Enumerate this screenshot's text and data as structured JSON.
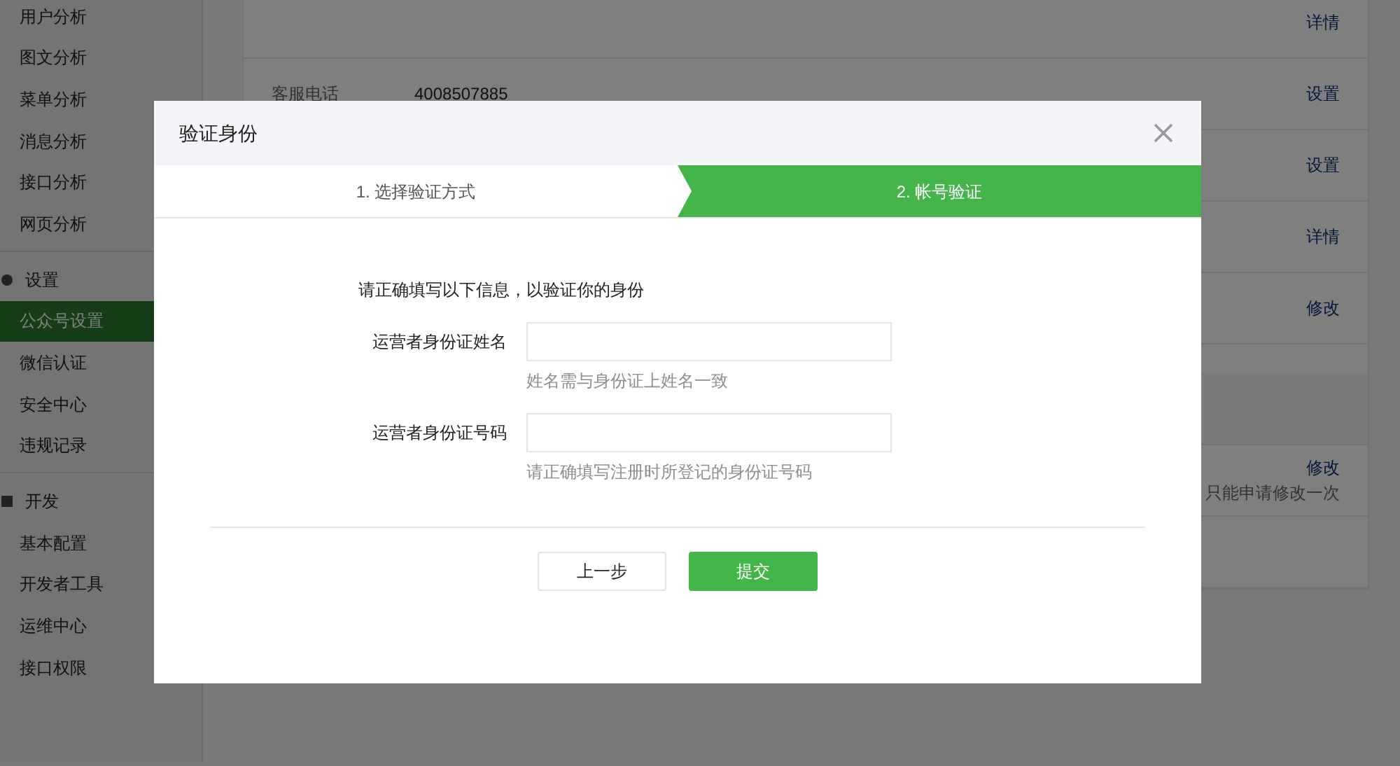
{
  "sidebar": {
    "groups": [
      {
        "items": [
          {
            "label": "用户分析",
            "selected": false
          },
          {
            "label": "图文分析",
            "selected": false
          },
          {
            "label": "菜单分析",
            "selected": false
          },
          {
            "label": "消息分析",
            "selected": false
          },
          {
            "label": "接口分析",
            "selected": false
          },
          {
            "label": "网页分析",
            "selected": false
          }
        ]
      },
      {
        "title": "设置",
        "items": [
          {
            "label": "公众号设置",
            "selected": true
          },
          {
            "label": "微信认证",
            "selected": false
          },
          {
            "label": "安全中心",
            "selected": false
          },
          {
            "label": "违规记录",
            "selected": false
          }
        ]
      },
      {
        "title": "开发",
        "items": [
          {
            "label": "基本配置",
            "selected": false
          },
          {
            "label": "开发者工具",
            "selected": false
          },
          {
            "label": "运维中心",
            "selected": false
          },
          {
            "label": "接口权限",
            "selected": false
          }
        ]
      }
    ]
  },
  "settings_rows": [
    {
      "kind": "row",
      "action": "详情"
    },
    {
      "kind": "row",
      "label": "客服电话",
      "value": "4008507885",
      "action": "设置"
    },
    {
      "kind": "row",
      "action": "设置"
    },
    {
      "kind": "row",
      "action": "详情"
    },
    {
      "kind": "row",
      "action": "修改"
    },
    {
      "kind": "band"
    },
    {
      "kind": "row",
      "action": "修改",
      "note": "只能申请修改一次"
    },
    {
      "kind": "row"
    }
  ],
  "dialog": {
    "title": "验证身份",
    "steps": [
      {
        "label": "1. 选择验证方式",
        "selected": false
      },
      {
        "label": "2. 帐号验证",
        "selected": true
      }
    ],
    "intro": "请正确填写以下信息，以验证你的身份",
    "fields": [
      {
        "label": "运营者身份证姓名",
        "hint": "姓名需与身份证上姓名一致"
      },
      {
        "label": "运营者身份证号码",
        "hint": "请正确填写注册时所登记的身份证号码"
      }
    ],
    "buttons": [
      {
        "label": "上一步",
        "kind": "secondary"
      },
      {
        "label": "提交",
        "kind": "primary"
      }
    ]
  }
}
